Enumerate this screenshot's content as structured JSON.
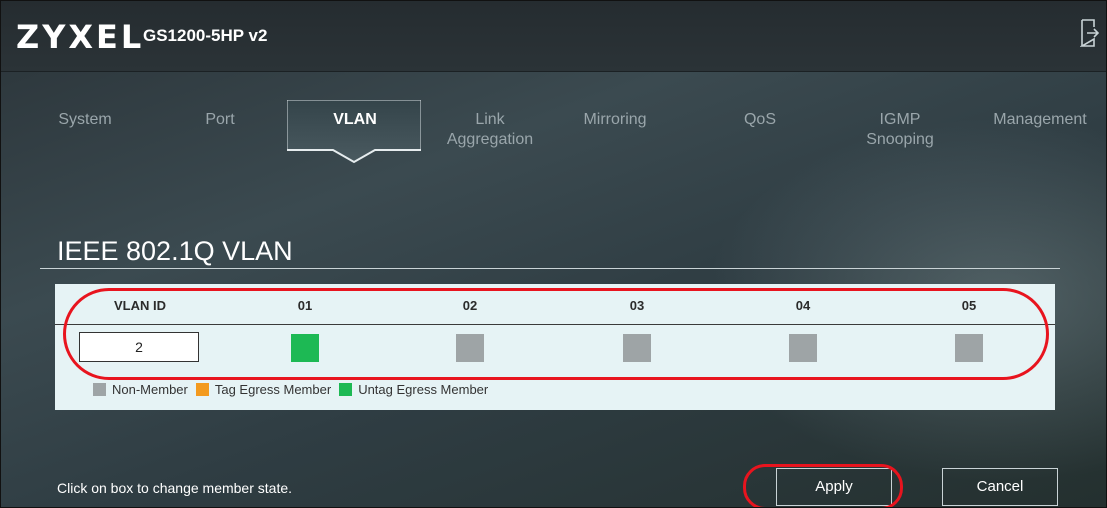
{
  "header": {
    "logo": "ZYXEL",
    "model": "GS1200-5HP v2",
    "logout_icon": "logout-icon"
  },
  "nav": {
    "tabs": [
      {
        "line1": "System",
        "line2": ""
      },
      {
        "line1": "Port",
        "line2": ""
      },
      {
        "line1": "VLAN",
        "line2": ""
      },
      {
        "line1": "Link",
        "line2": "Aggregation"
      },
      {
        "line1": "Mirroring",
        "line2": ""
      },
      {
        "line1": "QoS",
        "line2": ""
      },
      {
        "line1": "IGMP",
        "line2": "Snooping"
      },
      {
        "line1": "Management",
        "line2": ""
      }
    ],
    "active": "VLAN"
  },
  "section": {
    "title": "IEEE 802.1Q VLAN"
  },
  "vlan_table": {
    "headers": [
      "VLAN ID",
      "01",
      "02",
      "03",
      "04",
      "05"
    ],
    "row": {
      "vlan_id": "2",
      "ports": [
        "untag",
        "non",
        "non",
        "non",
        "non"
      ]
    }
  },
  "legend": [
    {
      "label": "Non-Member",
      "color": "#9ea4a6"
    },
    {
      "label": "Tag Egress Member",
      "color": "#f39a1e"
    },
    {
      "label": "Untag Egress Member",
      "color": "#1db954"
    }
  ],
  "footer": {
    "hint": "Click on box to change member state.",
    "apply_label": "Apply",
    "cancel_label": "Cancel"
  },
  "colors": {
    "non_member": "#9ea4a6",
    "tag_member": "#f39a1e",
    "untag_member": "#1db954",
    "annotation_red": "#e8141e"
  }
}
